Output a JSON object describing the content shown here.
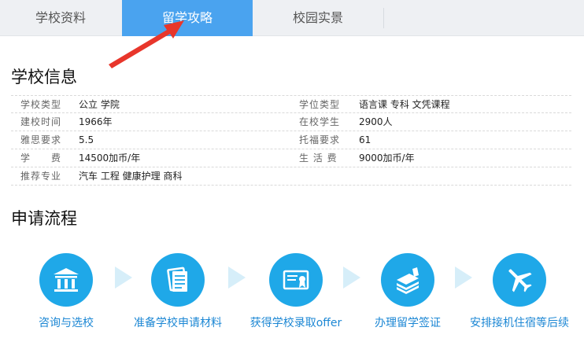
{
  "tabs": [
    {
      "label": "学校资料",
      "active": false
    },
    {
      "label": "留学攻略",
      "active": true
    },
    {
      "label": "校园实景",
      "active": false
    }
  ],
  "colors": {
    "active_tab": "#4aa3ef",
    "arrow": "#e8362b",
    "step_circle": "#1fa8e8",
    "step_text": "#1c87d4",
    "chevron": "#d6eef9"
  },
  "school_info": {
    "title": "学校信息",
    "rows": [
      {
        "label1": "学校类型",
        "value1": "公立 学院",
        "label2": "学位类型",
        "value2": "语言课 专科 文凭课程"
      },
      {
        "label1": "建校时间",
        "value1": "1966年",
        "label2": "在校学生",
        "value2": "2900人"
      },
      {
        "label1": "雅思要求",
        "value1": "5.5",
        "label2": "托福要求",
        "value2": "61"
      },
      {
        "label1": "学　　费",
        "value1": "14500加币/年",
        "label2": "生 活 费",
        "value2": "9000加币/年"
      },
      {
        "label1": "推荐专业",
        "value1": "汽车 工程 健康护理 商科",
        "label2": "",
        "value2": ""
      }
    ]
  },
  "process": {
    "title": "申请流程",
    "steps": [
      {
        "label": "咨询与选校",
        "icon": "building-icon"
      },
      {
        "label": "准备学校申请材料",
        "icon": "document-icon"
      },
      {
        "label": "获得学校录取offer",
        "icon": "certificate-icon"
      },
      {
        "label": "办理留学签证",
        "icon": "books-icon"
      },
      {
        "label": "安排接机住宿等后续",
        "icon": "airplane-icon"
      }
    ]
  }
}
